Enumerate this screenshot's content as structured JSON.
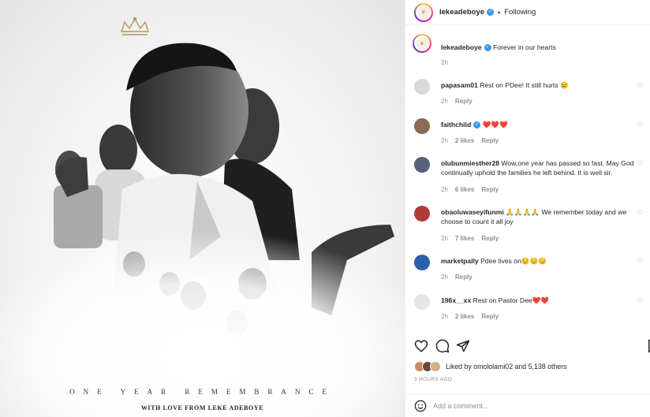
{
  "post": {
    "image_title": "ONE YEAR REMEMBRANCE",
    "image_subtitle": "WITH LOVE FROM LEKE ADEBOYE"
  },
  "header": {
    "username": "lekeadeboye",
    "separator": "•",
    "follow_label": "Following"
  },
  "caption": {
    "username": "lekeadeboye",
    "text": "Forever in our hearts",
    "time": "2h"
  },
  "comments": [
    {
      "username": "papasam01",
      "text": "Rest on PDee! It still hurts 😢",
      "time": "2h",
      "likes": "",
      "reply": "Reply",
      "avatar_color": "#d9d9d9"
    },
    {
      "username": "faithchild",
      "text": "❤️❤️❤️",
      "time": "2h",
      "likes": "2 likes",
      "reply": "Reply",
      "avatar_color": "#8a6b55"
    },
    {
      "username": "olubunmiesther28",
      "text": "Wow,one year has passed so fast. May God continually uphold the families he left behind. It is well sir.",
      "time": "2h",
      "likes": "6 likes",
      "reply": "Reply",
      "avatar_color": "#5a5f7a"
    },
    {
      "username": "obaoluwaseyifunmi",
      "text": "🙏🙏🙏🙏 We remember today and we choose to count it all joy",
      "time": "2h",
      "likes": "7 likes",
      "reply": "Reply",
      "avatar_color": "#b03a3a"
    },
    {
      "username": "marketpally",
      "text": "Pdee lives on😔😔😔",
      "time": "2h",
      "likes": "",
      "reply": "Reply",
      "avatar_color": "#2b5fa8"
    },
    {
      "username": "196x__xx",
      "text": "Rest on Pastor Dee❤️❤️",
      "time": "2h",
      "likes": "2 likes",
      "reply": "Reply",
      "avatar_color": "#e6e6e6"
    }
  ],
  "likes": {
    "text": "Liked by omololami02 and 5,138 others"
  },
  "timestamp": "3 HOURS AGO",
  "add_comment": {
    "placeholder": "Add a comment..."
  },
  "colors": {
    "verified": "#3897f0",
    "heart_red": "#ed4956",
    "muted": "#8e8e8e"
  }
}
